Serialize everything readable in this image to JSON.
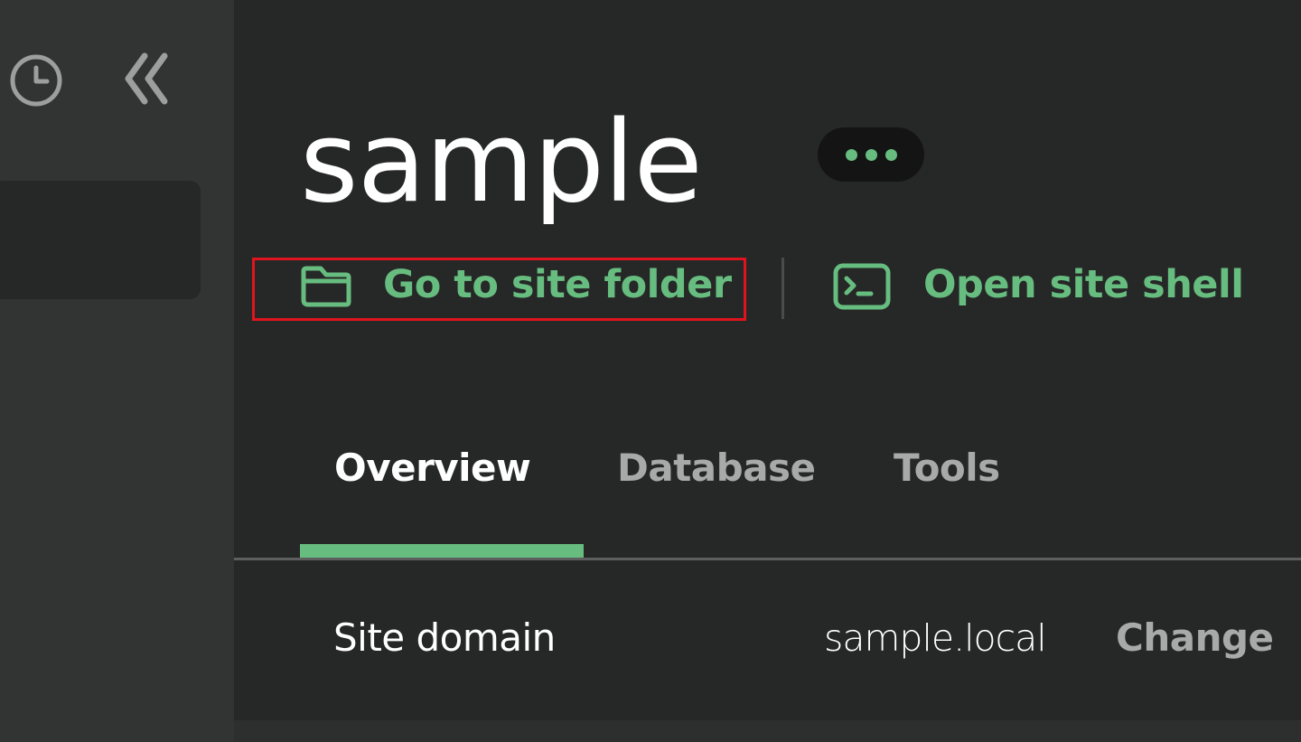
{
  "colors": {
    "accent": "#67bc7f",
    "background": "#262727",
    "sidebar": "#323333",
    "highlight_box": "#e0141e"
  },
  "sidebar": {
    "history_icon": "clock-icon",
    "collapse_icon": "chevrons-left-icon"
  },
  "site": {
    "name": "sample",
    "more_menu_icon": "ellipsis-icon"
  },
  "actions": {
    "folder": {
      "label": "Go to site folder",
      "icon": "folder-icon"
    },
    "shell": {
      "label": "Open site shell",
      "icon": "terminal-icon"
    }
  },
  "tabs": [
    {
      "label": "Overview",
      "active": true
    },
    {
      "label": "Database",
      "active": false
    },
    {
      "label": "Tools",
      "active": false
    }
  ],
  "overview": {
    "site_domain_label": "Site domain",
    "site_domain_value": "sample.local",
    "change_label": "Change"
  }
}
